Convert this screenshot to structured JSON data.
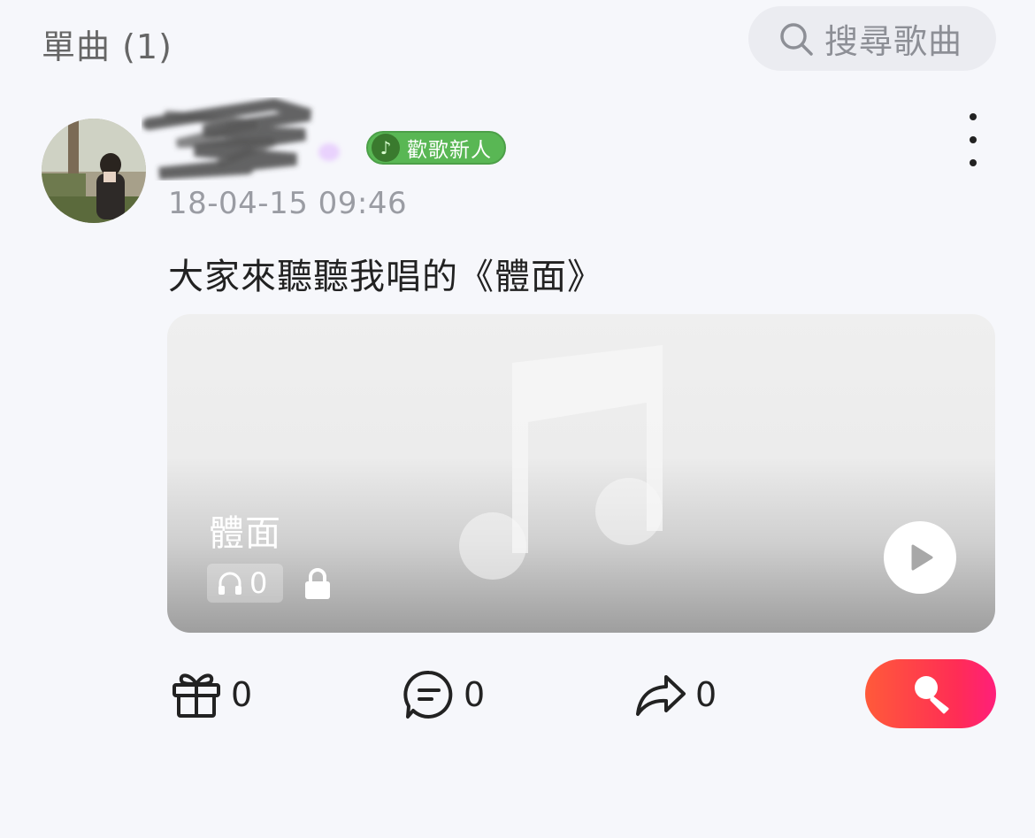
{
  "header": {
    "section_title": "單曲 (1)",
    "search_label": "搜尋歌曲"
  },
  "post": {
    "badge_label": "歡歌新人",
    "timestamp": "18-04-15 09:46",
    "text": "大家來聽聽我唱的《體面》",
    "song": {
      "title": "體面",
      "listen_count": "0"
    }
  },
  "actions": {
    "gift_count": "0",
    "comment_count": "0",
    "share_count": "0"
  },
  "colors": {
    "badge_green": "#59b754",
    "sing_gradient_start": "#ff5a3a",
    "sing_gradient_end": "#ff1f7a"
  },
  "icons": {
    "search": "search-icon",
    "more": "more-vertical-icon",
    "headphones": "headphones-icon",
    "lock": "lock-icon",
    "play": "play-icon",
    "gift": "gift-icon",
    "comment": "comment-icon",
    "share": "share-icon",
    "microphone": "microphone-icon"
  }
}
